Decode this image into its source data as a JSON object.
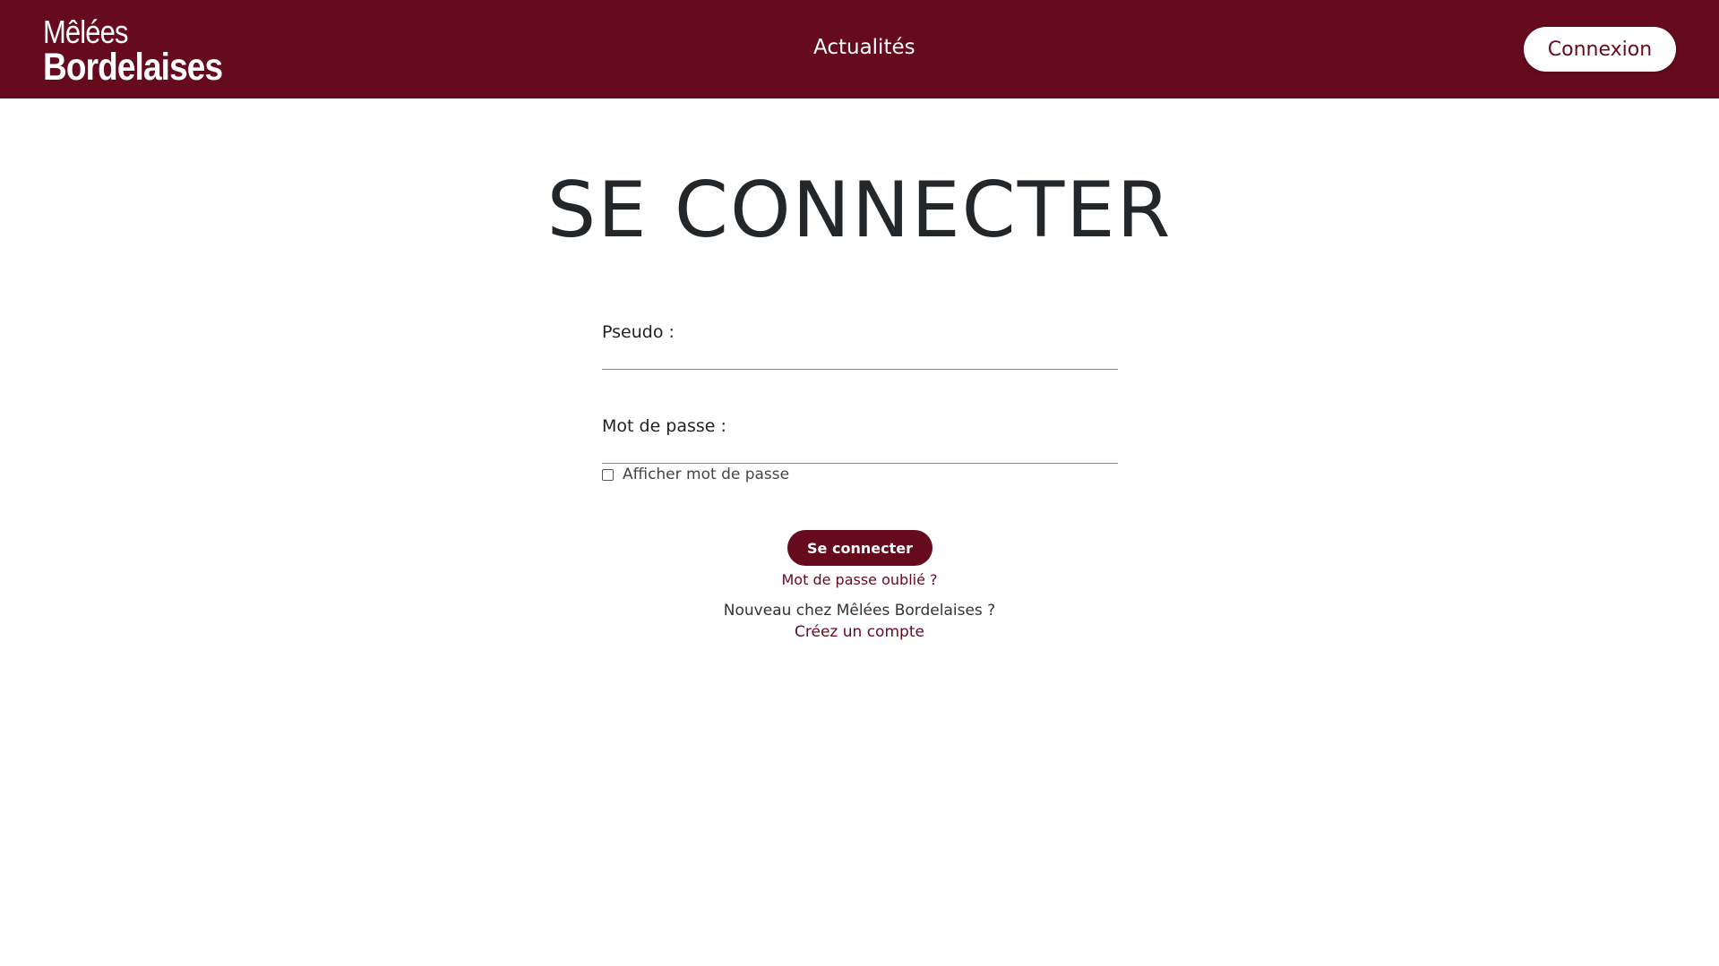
{
  "header": {
    "logo_line1": "Mêlées",
    "logo_line2": "Bordelaises",
    "nav_link": "Actualités",
    "login_button": "Connexion",
    "bg_color": "#660a1e"
  },
  "main": {
    "title": "SE CONNECTER",
    "username_label": "Pseudo :",
    "username_value": "",
    "password_label": "Mot de passe :",
    "password_value": "",
    "show_password_label": "Afficher mot de passe",
    "show_password_checked": false,
    "submit_label": "Se connecter",
    "forgot_password": "Mot de passe oublié ?",
    "new_user_text": "Nouveau chez Mêlées Bordelaises ?",
    "create_account": "Créez un compte",
    "accent_color": "#660a1e"
  }
}
